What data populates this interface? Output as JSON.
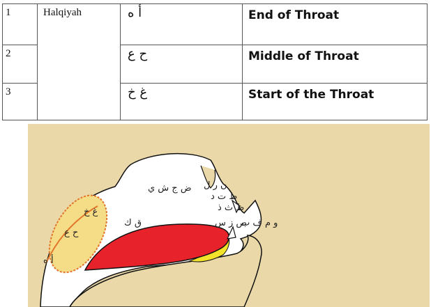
{
  "table": {
    "group_label": "Halqiyah",
    "rows": [
      {
        "num": "1",
        "letters": "أ ه",
        "description": "End of Throat"
      },
      {
        "num": "2",
        "letters": "ح ع",
        "description": "Middle of Throat"
      },
      {
        "num": "3",
        "letters": "غ خ",
        "description": "Start of the Throat"
      }
    ]
  },
  "diagram": {
    "labels": {
      "throat_upper": "غ خ",
      "throat_middle": "ح ع",
      "throat_lower": "أ ه",
      "back_tongue": "ق ك",
      "palate": "ض ج ش ي",
      "alveolar": "ن ر ل",
      "teeth": "ط ت د",
      "interdental": "ظ ث ذ",
      "sibilants": "ص ز س",
      "lips": "و م ف ب"
    },
    "colors": {
      "background_flesh": "#EAD8A8",
      "tongue": "#E8222A",
      "lower_tongue": "#F2E22A",
      "throat_highlight": "#F5DC86",
      "throat_outline": "#E2762A",
      "cavity": "#ffffff"
    }
  }
}
